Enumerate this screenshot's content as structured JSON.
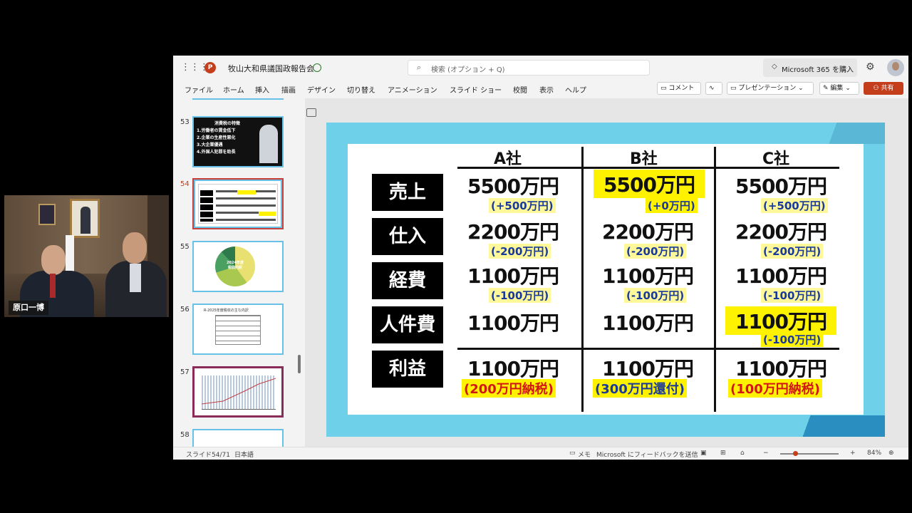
{
  "webcam": {
    "name": "原口一博"
  },
  "app": {
    "title": "牧山大和県議国政報告会",
    "search_placeholder": "検索 (オプション + Q)",
    "buy_label": "Microsoft 365 を購入",
    "menu": [
      "ファイル",
      "ホーム",
      "挿入",
      "描画",
      "デザイン",
      "切り替え",
      "アニメーション",
      "スライド ショー",
      "校閲",
      "表示",
      "ヘルプ"
    ],
    "buttons": {
      "comment": "コメント",
      "present": "プレゼンテーション",
      "edit": "編集",
      "share": "共有"
    }
  },
  "thumbnails": [
    {
      "num": "53",
      "lines": [
        "消費税の特徴",
        "1.労働者の賃金低下",
        "2.企業の生産性悪化",
        "3.大企業優遇",
        "4.外国人犯罪を助長"
      ]
    },
    {
      "num": "54"
    },
    {
      "num": "55",
      "texts": [
        "2024年度",
        "税収内訳"
      ]
    },
    {
      "num": "56",
      "texts": [
        "R-2025年度税収の主な内訳"
      ]
    },
    {
      "num": "57"
    },
    {
      "num": "58"
    }
  ],
  "slide": {
    "columns": [
      "A社",
      "B社",
      "C社"
    ],
    "rows": [
      {
        "label": "売上",
        "values": [
          "5500万円",
          "5500万円",
          "5500万円"
        ],
        "subs": [
          "(+500万円)",
          "(+0万円)",
          "(+500万円)"
        ]
      },
      {
        "label": "仕入",
        "values": [
          "2200万円",
          "2200万円",
          "2200万円"
        ],
        "subs": [
          "(-200万円)",
          "(-200万円)",
          "(-200万円)"
        ]
      },
      {
        "label": "経費",
        "values": [
          "1100万円",
          "1100万円",
          "1100万円"
        ],
        "subs": [
          "(-100万円)",
          "(-100万円)",
          "(-100万円)"
        ]
      },
      {
        "label": "人件費",
        "values": [
          "1100万円",
          "1100万円",
          "1100万円"
        ],
        "subs": [
          "",
          "",
          "(-100万円)"
        ]
      },
      {
        "label": "利益",
        "values": [
          "1100万円",
          "1100万円",
          "1100万円"
        ],
        "subs": [
          "(200万円納税)",
          "(300万円還付)",
          "(100万円納税)"
        ]
      }
    ]
  },
  "status": {
    "slide": "スライド54/71",
    "lang": "日本語",
    "notes": "メモ",
    "feedback": "Microsoft にフィードバックを送信",
    "zoom": "84%",
    "zoom_level": 0.25
  }
}
